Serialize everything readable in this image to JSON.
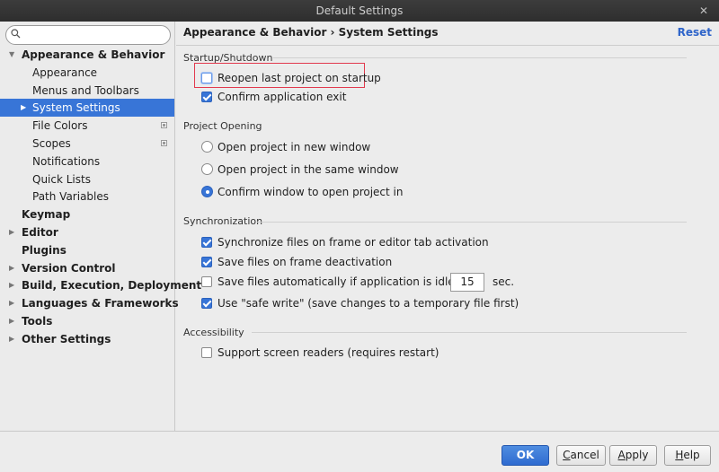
{
  "window": {
    "title": "Default Settings",
    "close_icon": "close-icon",
    "close_glyph": "✕"
  },
  "search": {
    "value": "",
    "placeholder": ""
  },
  "sidebar": {
    "items": [
      {
        "label": "Appearance & Behavior",
        "level": 0,
        "bold": true,
        "expanded": true
      },
      {
        "label": "Appearance",
        "level": 1
      },
      {
        "label": "Menus and Toolbars",
        "level": 1
      },
      {
        "label": "System Settings",
        "level": 1,
        "selected": true,
        "has_children": true
      },
      {
        "label": "File Colors",
        "level": 1,
        "copy_icon": true
      },
      {
        "label": "Scopes",
        "level": 1,
        "copy_icon": true
      },
      {
        "label": "Notifications",
        "level": 1
      },
      {
        "label": "Quick Lists",
        "level": 1
      },
      {
        "label": "Path Variables",
        "level": 1
      },
      {
        "label": "Keymap",
        "level": 0,
        "bold": true
      },
      {
        "label": "Editor",
        "level": 0,
        "bold": true,
        "has_children": true
      },
      {
        "label": "Plugins",
        "level": 0,
        "bold": true
      },
      {
        "label": "Version Control",
        "level": 0,
        "bold": true,
        "has_children": true
      },
      {
        "label": "Build, Execution, Deployment",
        "level": 0,
        "bold": true,
        "has_children": true
      },
      {
        "label": "Languages & Frameworks",
        "level": 0,
        "bold": true,
        "has_children": true
      },
      {
        "label": "Tools",
        "level": 0,
        "bold": true,
        "has_children": true
      },
      {
        "label": "Other Settings",
        "level": 0,
        "bold": true,
        "has_children": true
      }
    ]
  },
  "header": {
    "breadcrumb": "Appearance & Behavior › System Settings",
    "reset_label": "Reset"
  },
  "sections": {
    "startup": {
      "title": "Startup/Shutdown",
      "reopen_label": "Reopen last project on startup",
      "reopen_checked": false,
      "confirm_exit_label": "Confirm application exit",
      "confirm_exit_checked": true
    },
    "project_opening": {
      "title": "Project Opening",
      "options": [
        "Open project in new window",
        "Open project in the same window",
        "Confirm window to open project in"
      ],
      "selected_index": 2
    },
    "sync": {
      "title": "Synchronization",
      "sync_files_label": "Synchronize files on frame or editor tab activation",
      "sync_files_checked": true,
      "save_deactivation_label": "Save files on frame deactivation",
      "save_deactivation_checked": true,
      "save_idle_label": "Save files automatically if application is idle for",
      "save_idle_checked": false,
      "idle_seconds": "15",
      "idle_unit": "sec.",
      "safe_write_label": "Use \"safe write\" (save changes to a temporary file first)",
      "safe_write_checked": true
    },
    "accessibility": {
      "title": "Accessibility",
      "screen_readers_label": "Support screen readers (requires restart)",
      "screen_readers_checked": false
    }
  },
  "footer": {
    "ok_label": "OK",
    "cancel_prefix": "",
    "cancel_mnemonic": "C",
    "cancel_rest": "ancel",
    "apply_prefix": "",
    "apply_mnemonic": "A",
    "apply_rest": "pply",
    "help_prefix": "",
    "help_mnemonic": "H",
    "help_rest": "elp"
  },
  "colors": {
    "accent": "#3875d7",
    "highlight_box": "#e23a4e",
    "link": "#2f65ca"
  }
}
